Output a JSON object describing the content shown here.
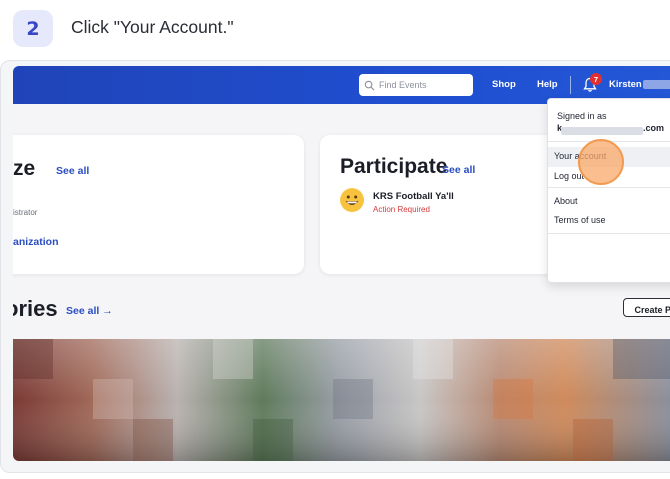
{
  "step": {
    "number": "2",
    "instruction": "Click \"Your Account.\""
  },
  "navbar": {
    "search_placeholder": "Find Events",
    "shop": "Shop",
    "help": "Help",
    "notification_count": "7",
    "user_name": "Kirsten"
  },
  "cards": {
    "organize": {
      "title_partial": "ze",
      "see_all": "See all",
      "role_partial": "istrator",
      "org_link_partial": "anization"
    },
    "participate": {
      "title": "Participate",
      "see_all": "See all",
      "event_name": "KRS Football Ya'll",
      "event_status": "Action Required"
    }
  },
  "stories": {
    "title_partial": "ories",
    "see_all": "See all →",
    "create_button_partial": "Create Po"
  },
  "dropdown": {
    "signed_in_as": "Signed in as",
    "email_start": "k",
    "email_end": ".com",
    "your_account": "Your account",
    "log_out": "Log out",
    "about": "About",
    "terms": "Terms of use"
  },
  "colors": {
    "brand_blue": "#1f4ed0",
    "link_blue": "#2a4dc0",
    "alert_red": "#d83a3a",
    "click_highlight": "#f29a4f"
  },
  "icons": [
    "search-icon",
    "bell-icon",
    "grinning-emoji-icon"
  ]
}
